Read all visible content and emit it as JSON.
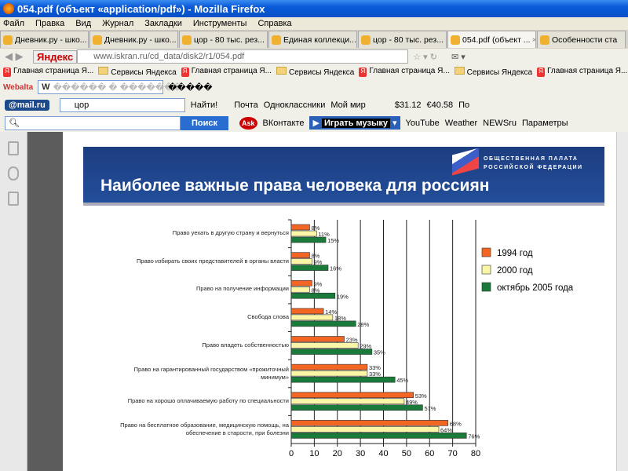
{
  "window": {
    "title": "054.pdf (объект «application/pdf») - Mozilla Firefox"
  },
  "menu": [
    "Файл",
    "Правка",
    "Вид",
    "Журнал",
    "Закладки",
    "Инструменты",
    "Справка"
  ],
  "tabs": [
    {
      "label": "Дневник.ру - шко..."
    },
    {
      "label": "Дневник.ру - шко..."
    },
    {
      "label": "цор - 80 тыс. рез..."
    },
    {
      "label": "Единая коллекци..."
    },
    {
      "label": "цор - 80 тыс. рез..."
    },
    {
      "label": "054.pdf (объект ...",
      "active": true
    },
    {
      "label": "Особенности ста"
    }
  ],
  "nav": {
    "yandex": "Яндекс",
    "url": "www.iskran.ru/cd_data/disk2/r1/054.pdf"
  },
  "bookmarks": [
    "Главная страница Я...",
    "Сервисы Яндекса",
    "Главная страница Я...",
    "Сервисы Яндекса",
    "Главная страница Я...",
    "Сервисы Яндекса",
    "Главная страница Я..."
  ],
  "webalta": {
    "logo": "Webalta",
    "field": "������ � �������",
    "extra": "�����"
  },
  "mailbar": {
    "logo": "@mail.ru",
    "query": "цор",
    "find": "Найти!",
    "items": [
      "Почта",
      "Одноклассники",
      "Мой мир"
    ],
    "usd": "31.12",
    "eur": "40.58",
    "more": "По"
  },
  "searchbar": {
    "button": "Поиск",
    "items": [
      "ВКонтакте",
      "Играть музыку",
      "YouTube",
      "Weather",
      "NEWSru",
      "Параметры"
    ]
  },
  "pdf": {
    "title": "Наиболее важные права человека для россиян",
    "org_line1": "ОБЩЕСТВЕННАЯ ПАЛАТА",
    "org_line2": "РОССИЙСКОЙ ФЕДЕРАЦИИ"
  },
  "chart_data": {
    "type": "bar",
    "orientation": "horizontal",
    "title": "Наиболее важные права человека для россиян",
    "categories": [
      "Право уехать в другую страну и вернуться",
      "Право избирать своих представителей в органы власти",
      "Право на получение информации",
      "Свобода слова",
      "Право владеть собственностью",
      "Право на гарантированный государством «прожиточный минимум»",
      "Право на хорошо оплачиваемую работу по специальности",
      "Право на бесплатное образование, медицинскую помощь, на обеспечение в старости, при болезни"
    ],
    "series": [
      {
        "name": "1994 год",
        "color": "#f26522",
        "values": [
          8,
          8,
          9,
          14,
          23,
          33,
          53,
          68
        ]
      },
      {
        "name": "2000 год",
        "color": "#fbf5a8",
        "values": [
          11,
          9,
          8,
          18,
          29,
          33,
          49,
          64
        ]
      },
      {
        "name": "октябрь 2005 года",
        "color": "#1a7a3a",
        "values": [
          15,
          16,
          19,
          28,
          35,
          45,
          57,
          76
        ]
      }
    ],
    "xlim": [
      0,
      80
    ],
    "xticks": [
      0,
      10,
      20,
      30,
      40,
      50,
      60,
      70,
      80
    ],
    "grid": true,
    "legend": "right",
    "unit": "%"
  }
}
